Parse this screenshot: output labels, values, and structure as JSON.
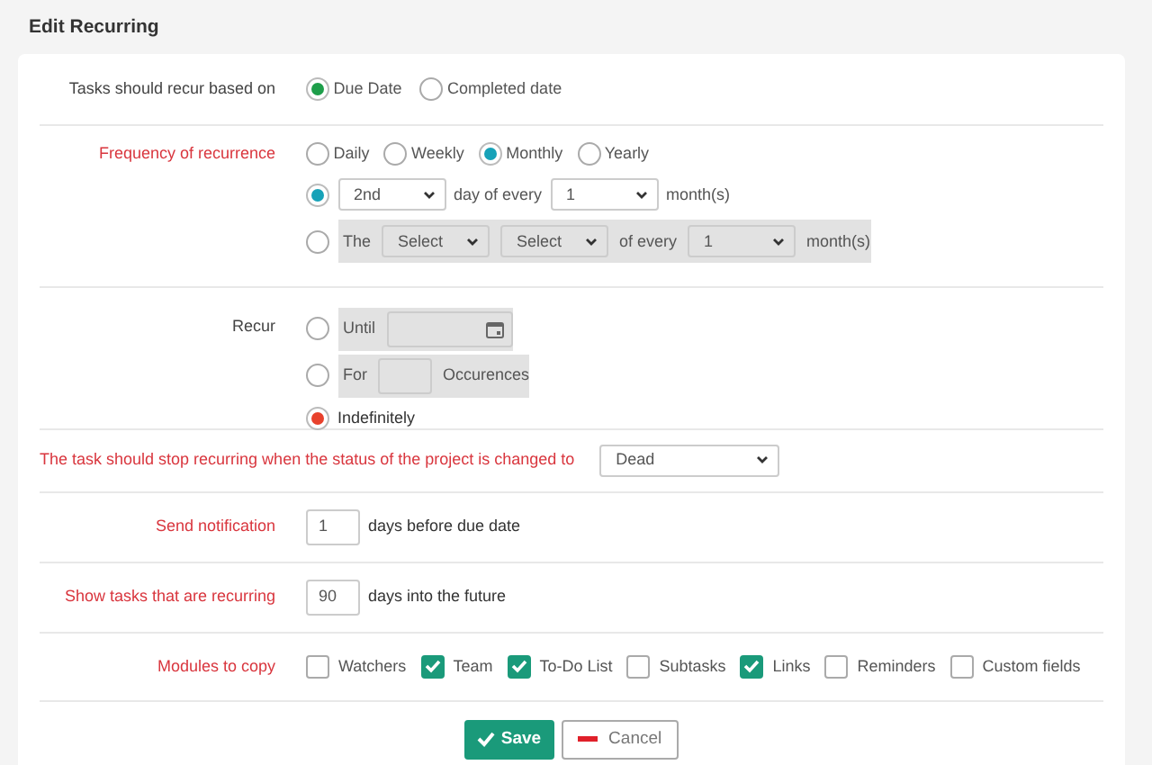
{
  "title": "Edit Recurring",
  "sections": [
    {
      "kind": "radio_inline",
      "label": "Tasks should recur based on",
      "required": false,
      "color": "#1e9e4a",
      "options": [
        {
          "label": "Due Date",
          "selected": true
        },
        {
          "label": "Completed date",
          "selected": false
        }
      ]
    },
    {
      "kind": "frequency",
      "label": "Frequency of recurrence",
      "required": true,
      "color": "#17a2b8",
      "options": [
        {
          "label": "Daily",
          "selected": false
        },
        {
          "label": "Weekly",
          "selected": false
        },
        {
          "label": "Monthly",
          "selected": true
        },
        {
          "label": "Yearly",
          "selected": false
        }
      ],
      "rows": [
        {
          "selected": true,
          "disabled": false,
          "parts": [
            {
              "kind": "select",
              "value": "2nd"
            },
            {
              "kind": "text",
              "value": "day of every"
            },
            {
              "kind": "select",
              "value": "1"
            },
            {
              "kind": "text",
              "value": "month(s)"
            }
          ]
        },
        {
          "selected": false,
          "disabled": true,
          "parts": [
            {
              "kind": "text",
              "value": "The"
            },
            {
              "kind": "select",
              "value": "Select"
            },
            {
              "kind": "select",
              "value": "Select"
            },
            {
              "kind": "text",
              "value": "of every"
            },
            {
              "kind": "select",
              "value": "1"
            },
            {
              "kind": "text",
              "value": "month(s)"
            }
          ]
        }
      ]
    },
    {
      "kind": "radio_rows",
      "label": "Recur",
      "required": false,
      "color": "#e8412c",
      "rows": [
        {
          "selected": false,
          "disabled": true,
          "parts": [
            {
              "kind": "text",
              "value": "Until"
            },
            {
              "kind": "date"
            }
          ]
        },
        {
          "selected": false,
          "disabled": true,
          "parts": [
            {
              "kind": "text",
              "value": "For"
            },
            {
              "kind": "input"
            },
            {
              "kind": "text",
              "value": "Occurences"
            }
          ]
        },
        {
          "selected": true,
          "disabled": false,
          "parts": [
            {
              "kind": "text",
              "value": "Indefinitely"
            }
          ]
        }
      ]
    },
    {
      "kind": "select_wide",
      "label": "The task should stop recurring when the status of the project is changed to",
      "required": true,
      "value": "Dead"
    },
    {
      "kind": "number",
      "label": "Send notification",
      "required": true,
      "value": "1",
      "suffix": "days before due date"
    },
    {
      "kind": "number",
      "label": "Show tasks that are recurring",
      "required": true,
      "value": "90",
      "suffix": "days into the future"
    },
    {
      "kind": "checks",
      "label": "Modules to copy",
      "required": true,
      "options": [
        {
          "label": "Watchers",
          "checked": false
        },
        {
          "label": "Team",
          "checked": true
        },
        {
          "label": "To-Do List",
          "checked": true
        },
        {
          "label": "Subtasks",
          "checked": false
        },
        {
          "label": "Links",
          "checked": true
        },
        {
          "label": "Reminders",
          "checked": false
        },
        {
          "label": "Custom fields",
          "checked": false
        }
      ]
    }
  ],
  "buttons": [
    {
      "kind": "save",
      "label": "Save"
    },
    {
      "kind": "cancel",
      "label": "Cancel"
    }
  ]
}
